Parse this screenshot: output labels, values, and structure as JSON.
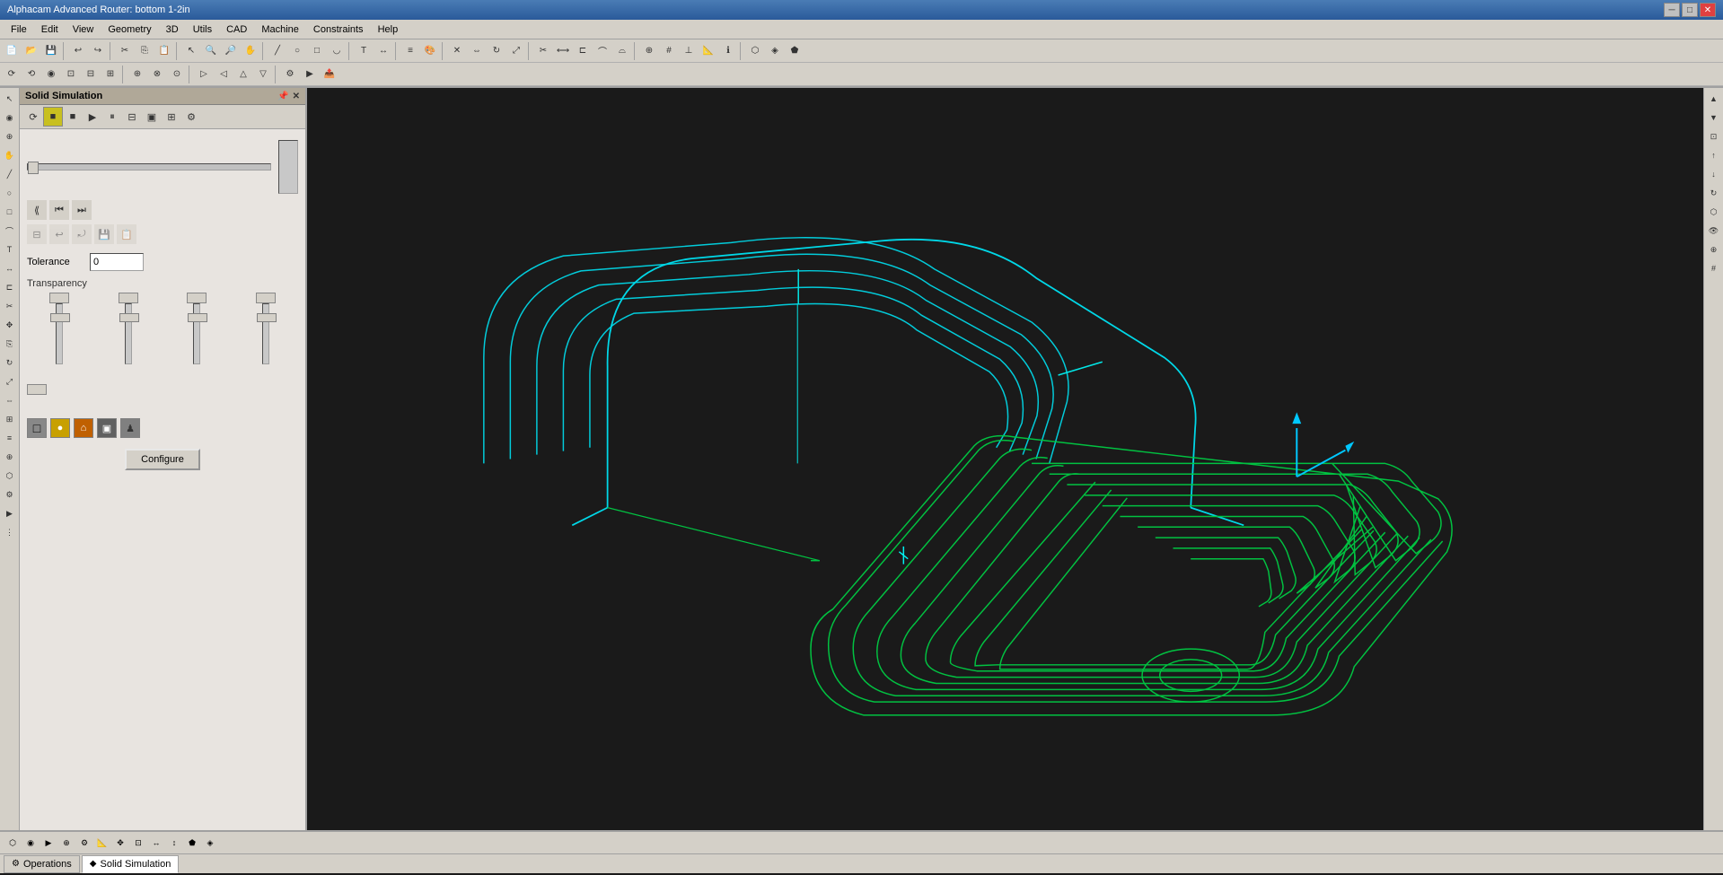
{
  "titlebar": {
    "title": "Alphacam Advanced Router: bottom 1-2in",
    "min_label": "─",
    "max_label": "□",
    "close_label": "✕"
  },
  "menubar": {
    "items": [
      "File",
      "Edit",
      "View",
      "Geometry",
      "3D",
      "Utils",
      "CAD",
      "Machine",
      "Constraints",
      "Help"
    ]
  },
  "panel": {
    "title": "Solid Simulation",
    "tolerance_label": "Tolerance",
    "tolerance_value": "0",
    "transparency_label": "Transparency",
    "configure_label": "Configure"
  },
  "bottom_tabs": [
    {
      "label": "Operations",
      "icon": "⚙"
    },
    {
      "label": "Solid Simulation",
      "icon": "◆"
    }
  ],
  "colors": {
    "viewport_bg": "#1a1a1a",
    "cad_cyan": "#00e5ff",
    "cad_green": "#00cc44",
    "panel_bg": "#e8e4e0",
    "toolbar_bg": "#d4d0c8"
  }
}
